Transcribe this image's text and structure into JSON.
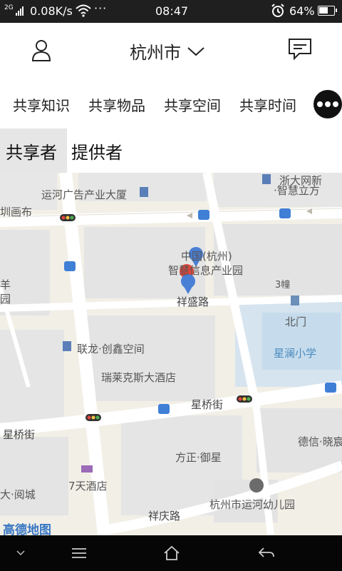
{
  "status_bar": {
    "signal_label": "2G",
    "net_speed": "0.08K/s",
    "more_indicator": "···",
    "time": "08:47",
    "battery_percent": "64%",
    "battery_level": 0.64,
    "icons": [
      "signal-icon",
      "wifi-icon",
      "alarm-icon",
      "battery-icon"
    ]
  },
  "header": {
    "city": "杭州市",
    "icons": [
      "user-icon",
      "chevron-down-icon",
      "message-icon"
    ]
  },
  "categories": {
    "items": [
      {
        "label": "共享知识"
      },
      {
        "label": "共享物品"
      },
      {
        "label": "共享空间"
      },
      {
        "label": "共享时间"
      }
    ],
    "more_icon": "more-dots-icon"
  },
  "role_tabs": {
    "items": [
      {
        "label": "共享者",
        "active": true
      },
      {
        "label": "提供者",
        "active": false
      }
    ]
  },
  "map": {
    "labels": {
      "l1": "运河广告产业大厦",
      "l2": "浙大网新",
      "l3": "·智慧立方",
      "l4": "中国(杭州)",
      "l5": "智慧信息产业园",
      "l6": "祥盛路",
      "l7": "3幢",
      "l8": "北门",
      "l9": "联龙·创鑫空间",
      "l10": "星澜小学",
      "l11": "瑞莱克斯大酒店",
      "l12": "星桥街",
      "l13": "星桥街",
      "l14": "德信·晓宸",
      "l15": "方正·御星",
      "l16": "7天酒店",
      "l17": "杭州市运河幼儿园",
      "l18": "祥庆路",
      "l19": "大·阅城",
      "l20": "圳画布",
      "l21": "羊",
      "l22": "园"
    },
    "logo": "高德地图",
    "markers": [
      "location-pin-blue",
      "location-pin-red",
      "location-pin-blue-2"
    ],
    "colors": {
      "background": "#f2efe7",
      "road": "#ffffff",
      "block": "#e3e3e3",
      "school": "#d6e4ef",
      "pin_blue": "#4a7fd6",
      "pin_red": "#e2453c"
    }
  },
  "nav_bar": {
    "icons": [
      "collapse-icon",
      "menu-icon",
      "home-icon",
      "back-icon"
    ]
  }
}
